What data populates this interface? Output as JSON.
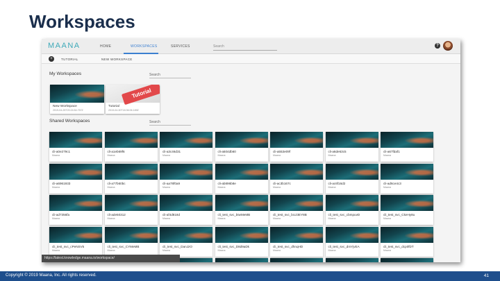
{
  "slide": {
    "title": "Workspaces",
    "footer_copyright": "Copyright © 2019 Maana, Inc.  All rights reserved.",
    "page_number": "41"
  },
  "app": {
    "logo": "MAANA",
    "nav": [
      {
        "label": "HOME",
        "active": false
      },
      {
        "label": "WORKSPACES",
        "active": true
      },
      {
        "label": "SERVICES",
        "active": false
      }
    ],
    "search_placeholder": "Search",
    "subnav": [
      {
        "label": "TUTORIAL"
      },
      {
        "label": "NEW WORKSPACE"
      }
    ]
  },
  "my_workspaces": {
    "title": "My Workspaces",
    "search_placeholder": "Search",
    "cards": [
      {
        "name": "New Workspace",
        "date": "2019-04-25T20:24:54.757Z",
        "thumb": "teal"
      },
      {
        "name": "Tutorial",
        "date": "2019-04-30T18:36:06.189Z",
        "thumb": "tutorial",
        "banner": "Tutorial"
      }
    ]
  },
  "shared_workspaces": {
    "title": "Shared Workspaces",
    "search_placeholder": "Search",
    "rows": [
      [
        {
          "label": "cli-a0e279c1",
          "owner": "Maana"
        },
        {
          "label": "cli-a1eb69f6",
          "owner": "Maana"
        },
        {
          "label": "cli-a3c46d31",
          "owner": "Maana"
        },
        {
          "label": "cli-a504db60",
          "owner": "Maana"
        },
        {
          "label": "cli-a553e09f",
          "owner": "Maana"
        },
        {
          "label": "cli-a6de63c5",
          "owner": "Maana"
        },
        {
          "label": "cli-a67fdaf1",
          "owner": "Maana"
        }
      ],
      [
        {
          "label": "cli-a6961933",
          "owner": "Maana"
        },
        {
          "label": "cli-a77b60bc",
          "owner": "Maana"
        },
        {
          "label": "cli-aa78f0a9",
          "owner": "Maana"
        },
        {
          "label": "cli-ab896b8e",
          "owner": "Maana"
        },
        {
          "label": "cli-ac3b167c",
          "owner": "Maana"
        },
        {
          "label": "cli-ac6f16d2",
          "owner": "Maana"
        },
        {
          "label": "cli-ad6ce4c3",
          "owner": "Maana"
        }
      ],
      [
        {
          "label": "cli-ad7356fa",
          "owner": "Maana"
        },
        {
          "label": "cli-ade50312",
          "owner": "Maana"
        },
        {
          "label": "cli-af4d818d",
          "owner": "Maana"
        },
        {
          "label": "cli_test_svc_btwMeMB",
          "owner": "Maana"
        },
        {
          "label": "cli_test_svc_bUJ3EY8B",
          "owner": "Maana"
        },
        {
          "label": "cli_test_svc_cbmpuvD",
          "owner": "Maana"
        },
        {
          "label": "cli_test_svc_CkeHy8u",
          "owner": "Maana"
        }
      ],
      [
        {
          "label": "cli_test_svc_cPeNSV5",
          "owner": "Maana"
        },
        {
          "label": "cli_test_svc_CYMeMB",
          "owner": "Maana"
        },
        {
          "label": "cli_test_svc_DanJzO",
          "owner": "Maana"
        },
        {
          "label": "cli_test_svc_D8d9aDk",
          "owner": "Maana"
        },
        {
          "label": "cli_test_svc_dhnqHD",
          "owner": "Maana"
        },
        {
          "label": "cli_test_svc_dmYjvEA",
          "owner": "Maana"
        },
        {
          "label": "cli_test_svc_dcp0fDT",
          "owner": "Maana"
        }
      ],
      [
        {
          "label": "",
          "owner": ""
        },
        {
          "label": "",
          "owner": ""
        },
        {
          "label": "",
          "owner": ""
        },
        {
          "label": "",
          "owner": ""
        },
        {
          "label": "",
          "owner": ""
        },
        {
          "label": "",
          "owner": ""
        },
        {
          "label": "",
          "owner": ""
        }
      ]
    ]
  },
  "status_url": "https://latest.knowledge.maana.io/workspace/"
}
